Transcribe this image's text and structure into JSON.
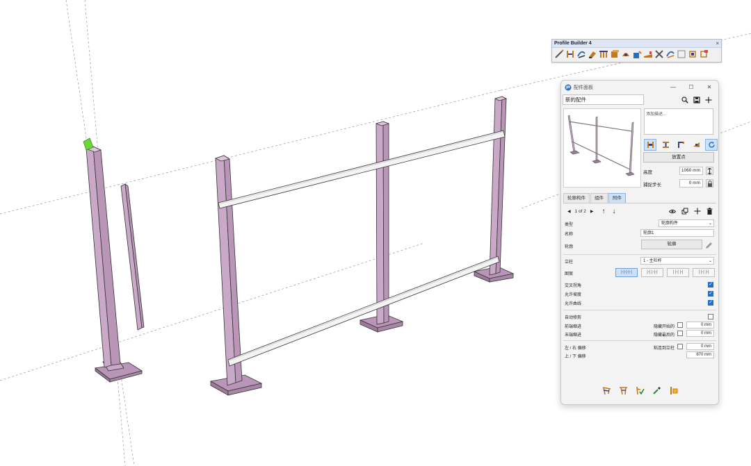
{
  "toolbar": {
    "title": "Profile Builder 4",
    "close": "×",
    "icons": [
      "pencil-profile-icon",
      "path-profile-icon",
      "follow-me-icon",
      "paint-icon",
      "assembly-icon",
      "box-profile-icon",
      "hide-icon",
      "bucket-icon",
      "shape-icon",
      "eraser-icon",
      "cut-icon",
      "intersect-icon",
      "frame-icon",
      "frame-tag-icon"
    ]
  },
  "panel": {
    "title": "配件面板",
    "window_controls": {
      "minimize": "—",
      "maximize": "☐",
      "close": "✕"
    },
    "name_value": "新的配件",
    "description_placeholder": "添加描述...",
    "place_button": "放置点",
    "height_label": "高度",
    "height_value": "1060 mm",
    "snap_label": "捕捉步长",
    "snap_value": "0 mm",
    "tabs": [
      "轮廓构件",
      "组件",
      "附件"
    ],
    "active_tab": 2,
    "pager_text": "1 of 2",
    "type_label": "类型",
    "type_value": "轮廓构件",
    "name_label": "名称",
    "name_field_value": "轮廓1",
    "profile_label": "轮廓",
    "profile_button": "轮廓",
    "post_label": "立柱",
    "post_value": "1 - 主栏杆",
    "pattern_label": "图案",
    "patterns": [
      "|-|-|-|-|",
      "|-|  |-|-|",
      "|  |-|  |-|",
      "|  |-|  |-|"
    ],
    "cross_corner_label": "交叉拐角",
    "allow_slope_label": "允许坡度",
    "allow_curve_label": "允许曲线",
    "auto_trim_label": "自动修剪",
    "front_offset_label": "前端缩进",
    "end_offset_label": "末端缩进",
    "hide_start_label": "隐藏开始的",
    "hide_end_label": "隐藏最后的",
    "front_offset_value": "0 mm",
    "end_offset_value": "0 mm",
    "lr_offset_label": "左 / 右 偏移",
    "snap_post_label": "粘连到立柱",
    "lr_offset_value": "0 mm",
    "ud_offset_label": "上 / 下 偏移",
    "ud_offset_value": "870 mm"
  },
  "colors": {
    "post": "#c9a9c7",
    "rail": "#f2f2f2",
    "selected": "#6fd63a",
    "accent": "#1f6fd1"
  }
}
